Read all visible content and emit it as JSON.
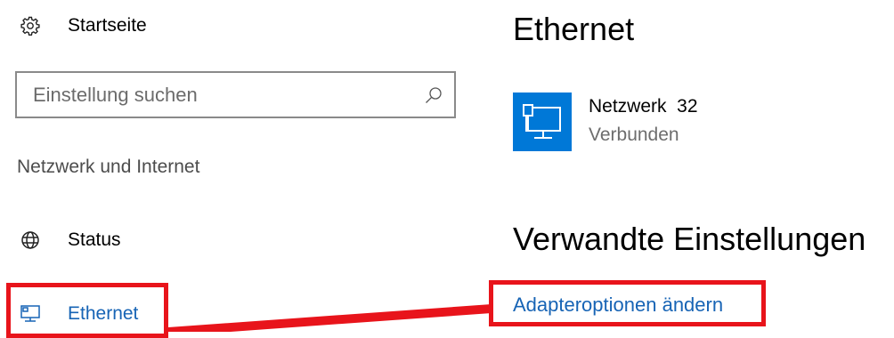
{
  "sidebar": {
    "home": {
      "label": "Startseite",
      "icon": "gear-icon"
    },
    "search": {
      "placeholder": "Einstellung suchen",
      "value": "",
      "icon": "search-icon"
    },
    "section_title": "Netzwerk und Internet",
    "items": [
      {
        "label": "Status",
        "icon": "globe-icon"
      },
      {
        "label": "Ethernet",
        "icon": "ethernet-icon",
        "selected": true
      }
    ]
  },
  "main": {
    "title": "Ethernet",
    "network": {
      "name": "Netzwerk  32",
      "status": "Verbunden",
      "icon": "ethernet-monitor-icon"
    },
    "related_title": "Verwandte Einstellungen",
    "related_link": "Adapteroptionen ändern"
  },
  "colors": {
    "accent": "#0078d7",
    "link": "#1764b5",
    "annotation": "#e8141b",
    "secondary_text": "#6d6d6d"
  }
}
